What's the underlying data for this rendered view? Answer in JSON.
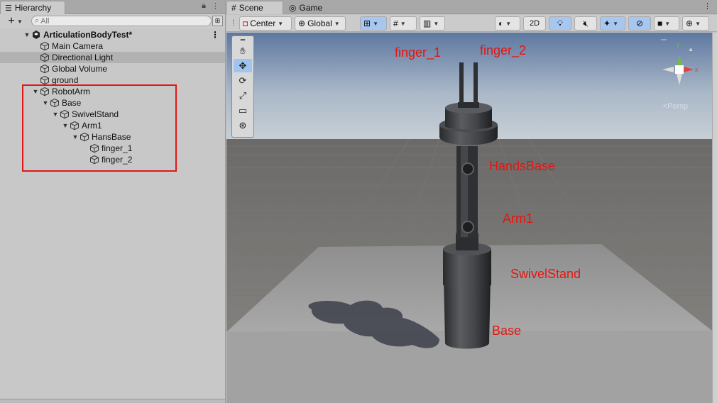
{
  "hierarchy": {
    "tab_label": "Hierarchy",
    "search_placeholder": "All",
    "scene_name": "ArticulationBodyTest*",
    "items": [
      {
        "label": "Main Camera",
        "depth": 1,
        "arrow": false
      },
      {
        "label": "Directional Light",
        "depth": 1,
        "arrow": false,
        "selected": true
      },
      {
        "label": "Global Volume",
        "depth": 1,
        "arrow": false
      },
      {
        "label": "ground",
        "depth": 1,
        "arrow": false
      },
      {
        "label": "RobotArm",
        "depth": 1,
        "arrow": true
      },
      {
        "label": "Base",
        "depth": 2,
        "arrow": true
      },
      {
        "label": "SwivelStand",
        "depth": 3,
        "arrow": true
      },
      {
        "label": "Arm1",
        "depth": 4,
        "arrow": true
      },
      {
        "label": "HansBase",
        "depth": 5,
        "arrow": true
      },
      {
        "label": "finger_1",
        "depth": 6,
        "arrow": false
      },
      {
        "label": "finger_2",
        "depth": 6,
        "arrow": false
      }
    ]
  },
  "scene": {
    "tabs": [
      {
        "label": "Scene",
        "icon": "grid-icon"
      },
      {
        "label": "Game",
        "icon": "gamepad-icon"
      }
    ],
    "toolbar": {
      "pivot": "Center",
      "space": "Global",
      "mode_2d": "2D"
    },
    "labels": {
      "finger_1": "finger_1",
      "finger_2": "finger_2",
      "hands_base": "HandsBase",
      "arm1": "Arm1",
      "swivel": "SwivelStand",
      "base": "Base"
    },
    "gizmo": {
      "y": "y",
      "x": "x",
      "persp": "<Persp"
    },
    "colors": {
      "annotation": "#e8140f",
      "selection_box": "#e01818",
      "active_tool": "#9fc4ef"
    }
  }
}
